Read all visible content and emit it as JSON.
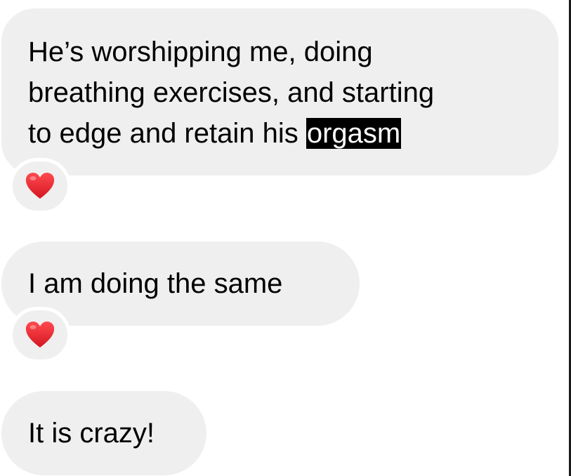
{
  "messages": [
    {
      "lines": [
        "He’s worshipping me, doing",
        "breathing exercises, and starting",
        "to edge and retain his "
      ],
      "highlighted": "orgasm",
      "reaction": "heart-icon"
    },
    {
      "text": "I am doing the same",
      "reaction": "heart-icon"
    },
    {
      "text": "It is crazy!"
    }
  ],
  "colors": {
    "bubble": "#efeff0",
    "highlight_bg": "#000000",
    "highlight_text": "#ffffff",
    "heart": "#e5232d"
  }
}
